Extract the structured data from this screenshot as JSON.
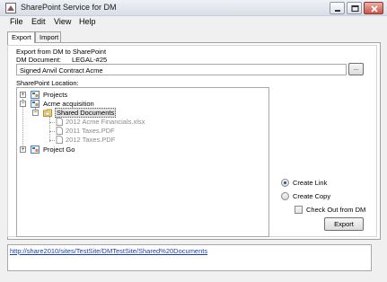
{
  "window": {
    "title": "SharePoint Service for DM"
  },
  "menu": [
    "File",
    "Edit",
    "View",
    "Help"
  ],
  "tabs": [
    {
      "label": "Export",
      "active": true
    },
    {
      "label": "Import",
      "active": false
    }
  ],
  "export": {
    "group_label": "Export from DM to SharePoint",
    "dm_document_label": "DM Document:",
    "dm_document_value": "LEGAL-#25",
    "document_name": "Signed Anvil Contract Acme",
    "browse_label": "...",
    "location_label": "SharePoint Location:",
    "tree": {
      "projects": "Projects",
      "acme": "Acme acquisition",
      "shared": "Shared Documents",
      "files": [
        "2012 Acme Financials.xlsx",
        "2011 Taxes.PDF",
        "2012 Taxes.PDF"
      ],
      "project_go": "Project Go"
    },
    "options": {
      "create_link": "Create Link",
      "create_copy": "Create Copy",
      "check_out": "Check Out from DM",
      "selected": "create_link"
    },
    "export_button": "Export"
  },
  "status": {
    "link": "http://share2010/sites/TestSite/DMTestSite/Shared%20Documents"
  }
}
